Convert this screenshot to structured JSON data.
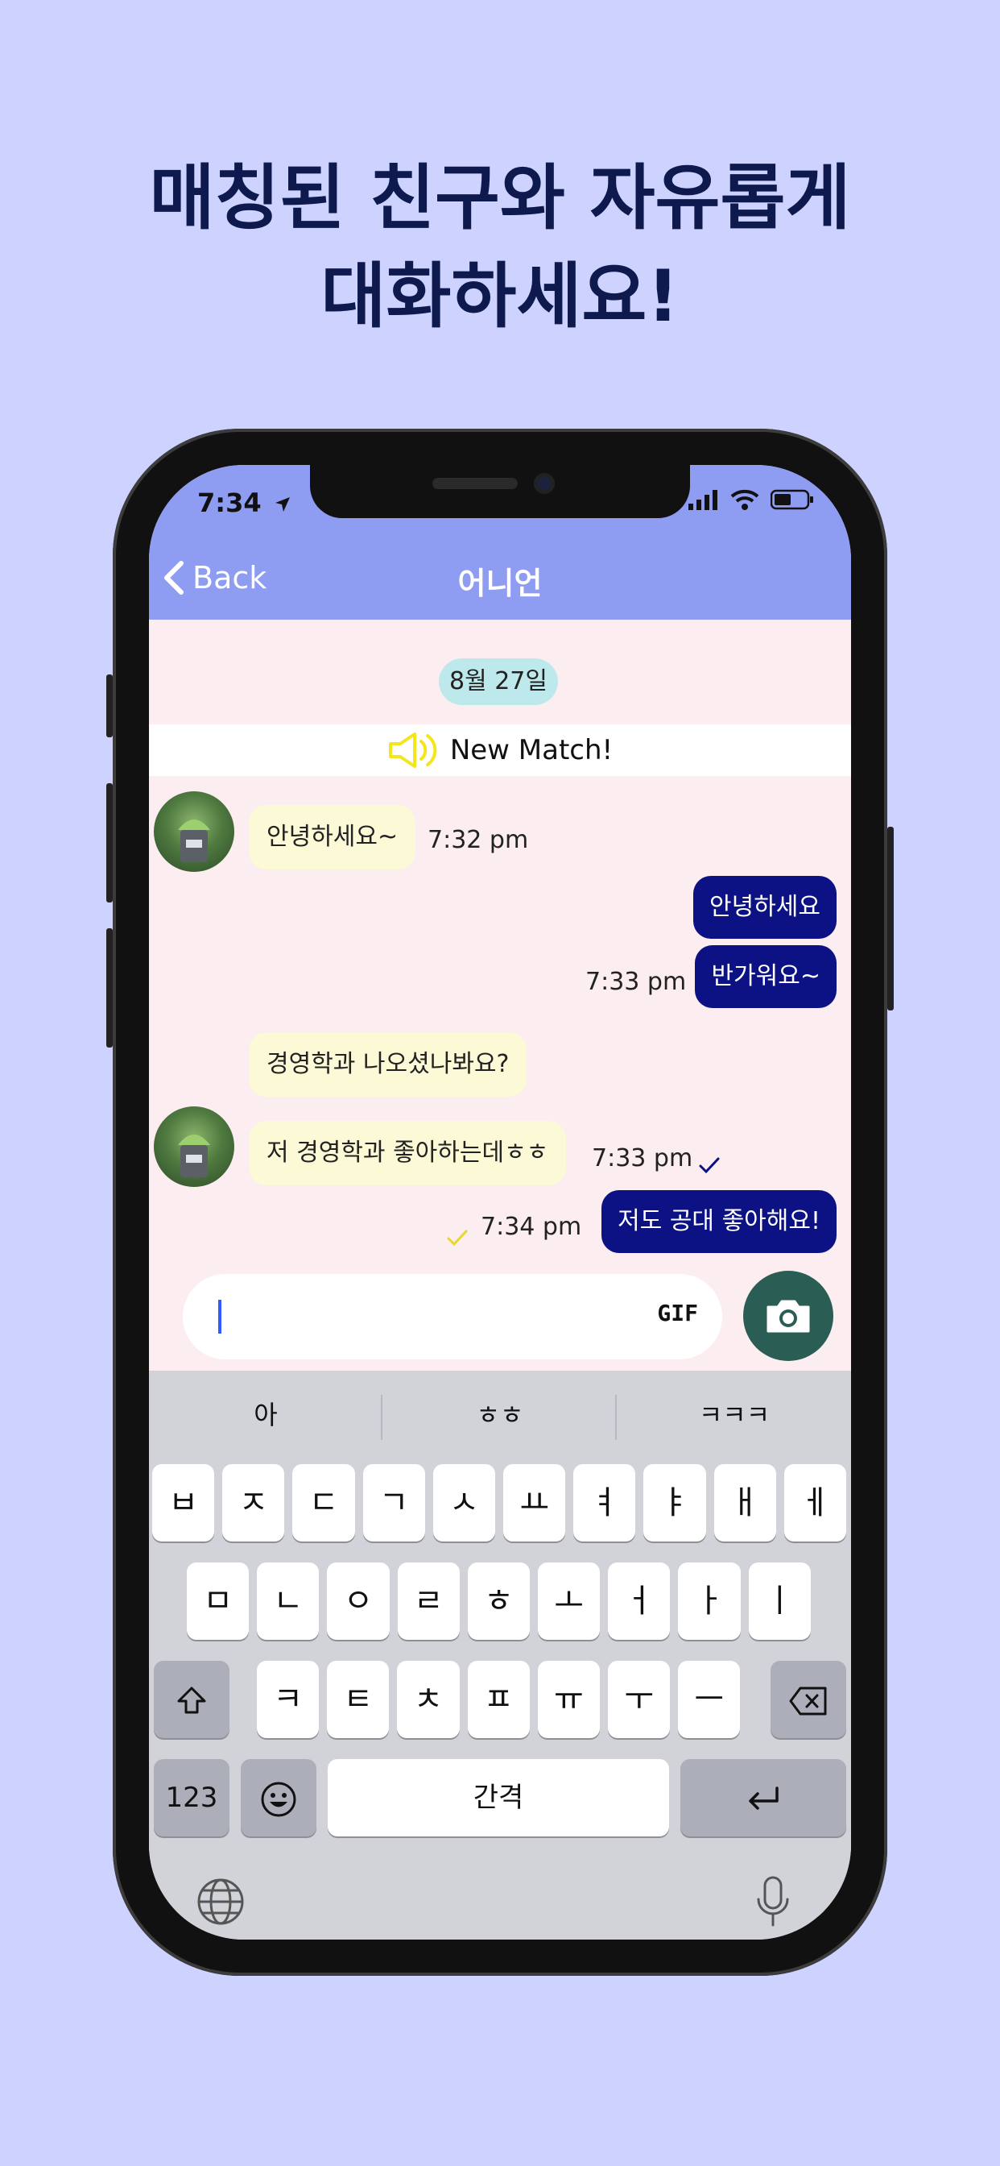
{
  "headline": {
    "line1": "매칭된 친구와 자유롭게",
    "line2": "대화하세요!"
  },
  "status_bar": {
    "time": "7:34"
  },
  "nav": {
    "back_label": "Back",
    "title": "어니언"
  },
  "chat": {
    "date": "8월 27일",
    "new_match": "New Match!",
    "messages": [
      {
        "side": "in",
        "text": "안녕하세요~",
        "time": "7:32 pm"
      },
      {
        "side": "out",
        "text": "안녕하세요"
      },
      {
        "side": "out",
        "text": "반가워요~",
        "time": "7:33 pm"
      },
      {
        "side": "in",
        "text": "경영학과 나오셨나봐요?"
      },
      {
        "side": "in",
        "text": "저 경영학과 좋아하는데ㅎㅎ",
        "time": "7:33 pm"
      },
      {
        "side": "out",
        "text": "저도 공대 좋아해요!",
        "time": "7:34 pm"
      }
    ]
  },
  "composer": {
    "value": "",
    "gif_label": "GIF"
  },
  "keyboard": {
    "suggestions": [
      "아",
      "ㅎㅎ",
      "ㅋㅋㅋ"
    ],
    "row1": [
      "ㅂ",
      "ㅈ",
      "ㄷ",
      "ㄱ",
      "ㅅ",
      "ㅛ",
      "ㅕ",
      "ㅑ",
      "ㅐ",
      "ㅔ"
    ],
    "row2": [
      "ㅁ",
      "ㄴ",
      "ㅇ",
      "ㄹ",
      "ㅎ",
      "ㅗ",
      "ㅓ",
      "ㅏ",
      "ㅣ"
    ],
    "row3": [
      "ㅋ",
      "ㅌ",
      "ㅊ",
      "ㅍ",
      "ㅠ",
      "ㅜ",
      "ㅡ"
    ],
    "numbers_label": "123",
    "space_label": "간격"
  },
  "colors": {
    "background": "#cdd3fe",
    "header": "#8e9cf2",
    "chat_bg": "#fcedf1",
    "bubble_in": "#fbf9d6",
    "bubble_out": "#0c1283",
    "camera_button": "#2a5d53"
  }
}
